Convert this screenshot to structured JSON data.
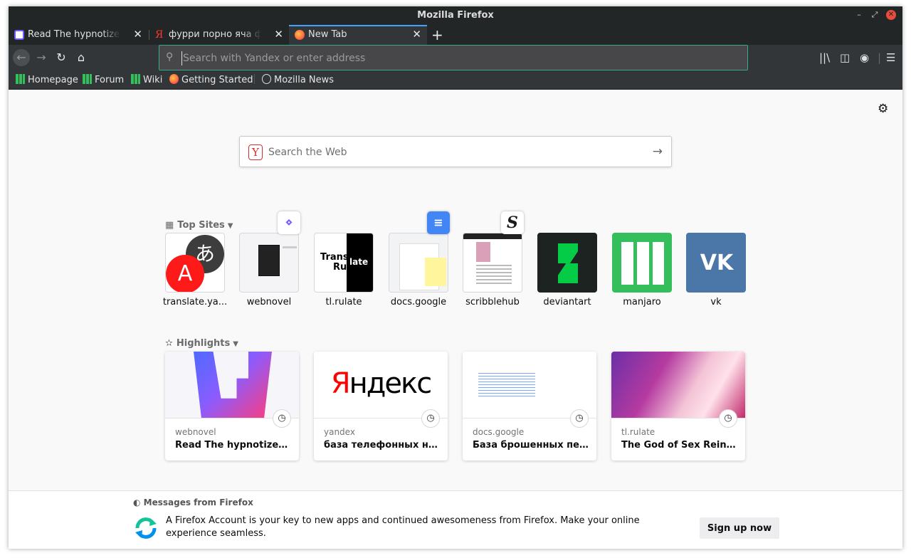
{
  "window": {
    "title": "Mozilla Firefox"
  },
  "tabs": [
    {
      "label": "Read The hypnotizer - C",
      "favicon": "webnovel-icon"
    },
    {
      "label": "фурри порно яча феле",
      "favicon": "yandex-icon"
    },
    {
      "label": "New Tab",
      "favicon": "firefox-icon",
      "active": true
    }
  ],
  "urlbar": {
    "placeholder": "Search with Yandex or enter address"
  },
  "bookmarks": [
    {
      "label": "Homepage"
    },
    {
      "label": "Forum"
    },
    {
      "label": "Wiki"
    },
    {
      "label": "Getting Started"
    },
    {
      "label": "Mozilla News"
    }
  ],
  "search": {
    "placeholder": "Search the Web"
  },
  "top_sites": {
    "title": "Top Sites",
    "items": [
      {
        "name": "translate.ya..."
      },
      {
        "name": "webnovel"
      },
      {
        "name": "tl.rulate"
      },
      {
        "name": "docs.google"
      },
      {
        "name": "scribblehub"
      },
      {
        "name": "deviantart"
      },
      {
        "name": "manjaro"
      },
      {
        "name": "vk"
      }
    ]
  },
  "tile_text": {
    "translate_a": "A",
    "translate_jp": "あ",
    "rulate_1": "Trans",
    "rulate_2": "Ru",
    "rulate_3": "late",
    "vk": "VK",
    "yandex_logo": "Яндекс"
  },
  "highlights": {
    "title": "Highlights",
    "items": [
      {
        "source": "webnovel",
        "title": "Read The hypnotizer - Chapter"
      },
      {
        "source": "yandex",
        "title": "база телефонных номеров"
      },
      {
        "source": "docs.google",
        "title": "База брошенных переводов"
      },
      {
        "source": "tl.rulate",
        "title": "The God of Sex Reincarnated"
      }
    ]
  },
  "messages": {
    "title": "Messages from Firefox",
    "text": "A Firefox Account is your key to new apps and continued awesomeness from Firefox. Make your online experience seamless.",
    "button": "Sign up now"
  },
  "colors": {
    "accent": "#45a1ff",
    "urlbar_border": "#3aa88a",
    "manjaro_green": "#35bf5c",
    "vk_blue": "#4a76a8"
  }
}
